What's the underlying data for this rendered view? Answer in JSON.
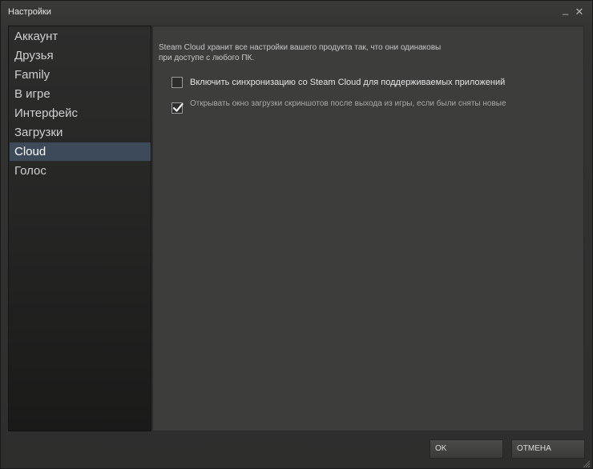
{
  "window": {
    "title": "Настройки",
    "minimize_glyph": "_",
    "close_glyph": "✕"
  },
  "sidebar": {
    "items": [
      {
        "label": "Аккаунт",
        "active": false
      },
      {
        "label": "Друзья",
        "active": false
      },
      {
        "label": "Family",
        "active": false
      },
      {
        "label": "В игре",
        "active": false
      },
      {
        "label": "Интерфейс",
        "active": false
      },
      {
        "label": "Загрузки",
        "active": false
      },
      {
        "label": "Cloud",
        "active": true
      },
      {
        "label": "Голос",
        "active": false
      }
    ]
  },
  "cloud": {
    "description": "Steam Cloud хранит все настройки вашего продукта так, что они одинаковы при доступе с любого ПК.",
    "options": [
      {
        "label": "Включить синхронизацию со Steam Cloud для поддерживаемых приложений",
        "checked": false
      },
      {
        "label": "Открывать окно загрузки скриншотов после выхода из игры, если были сняты новые",
        "checked": true
      }
    ]
  },
  "buttons": {
    "ok": "OK",
    "cancel": "ОТМЕНА"
  },
  "icons": {
    "minimize": "minimize-icon",
    "close": "close-icon",
    "check": "checkmark-icon",
    "grip": "resize-grip-icon"
  },
  "colors": {
    "active_item": "#3c4a5a",
    "content_bg": "#3d3d3c",
    "window_bg": "#333332"
  }
}
